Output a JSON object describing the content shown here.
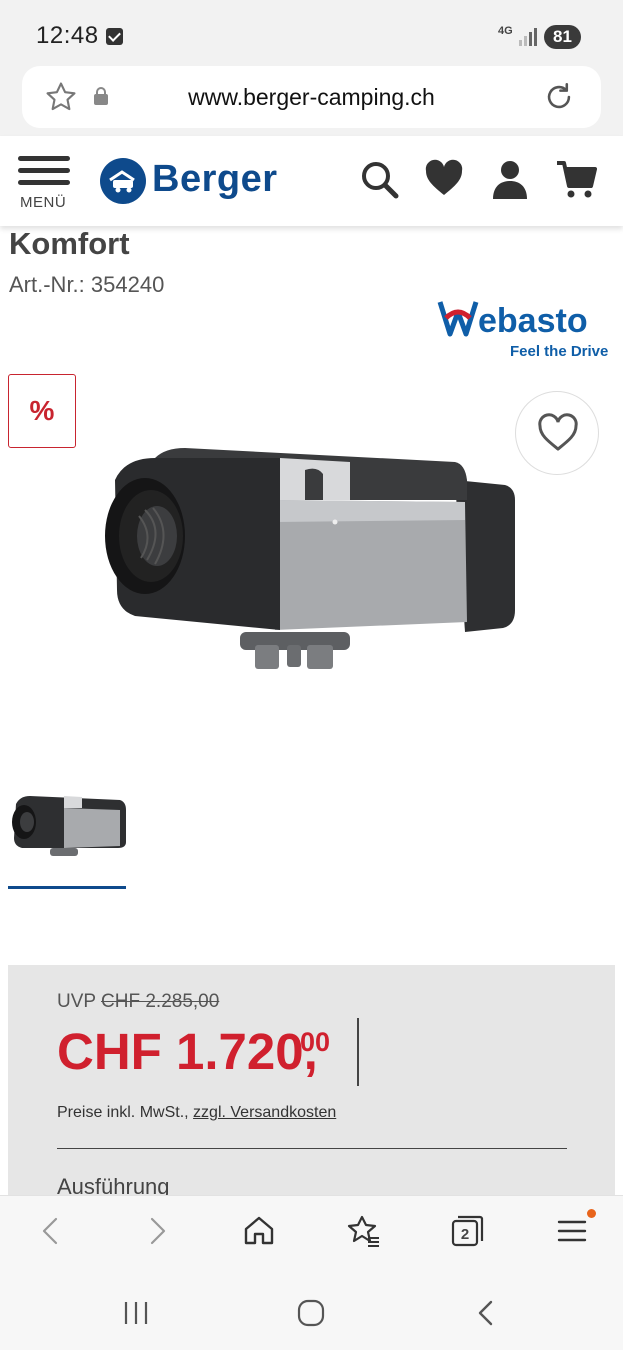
{
  "status_bar": {
    "time": "12:48",
    "network": "4G",
    "battery": "81"
  },
  "browser": {
    "url": "www.berger-camping.ch",
    "icons": [
      "star-outline-icon",
      "lock-icon",
      "reload-icon"
    ],
    "tab_count": "2",
    "toolbar_icons": [
      "back-icon",
      "forward-icon",
      "home-icon",
      "bookmarks-icon",
      "tabs-icon",
      "menu-icon"
    ]
  },
  "site_header": {
    "menu_label": "MENÜ",
    "logo_text": "Berger",
    "icons": [
      "search-icon",
      "heart-icon",
      "user-icon",
      "cart-icon"
    ],
    "brand_color": "#0e4a8c"
  },
  "product": {
    "title": "Komfort",
    "article_label": "Art.-Nr.:",
    "article_number": "354240",
    "brand_logo": "Webasto",
    "brand_tagline": "Feel the Drive",
    "sale_badge": "%",
    "wishlist_icon": "heart-outline-icon"
  },
  "price": {
    "uvp_label": "UVP",
    "uvp_value": "CHF 2.285,00",
    "current_main": "CHF 1.720,",
    "current_cents": "00",
    "tax_note": "Preise inkl. MwSt.,",
    "shipping_link": "zzgl. Versandkosten",
    "variant_label": "Ausführung",
    "accent_color": "#d0202e"
  },
  "system_nav": {
    "icons": [
      "recents-icon",
      "home-circle-icon",
      "back-chevron-icon"
    ]
  }
}
